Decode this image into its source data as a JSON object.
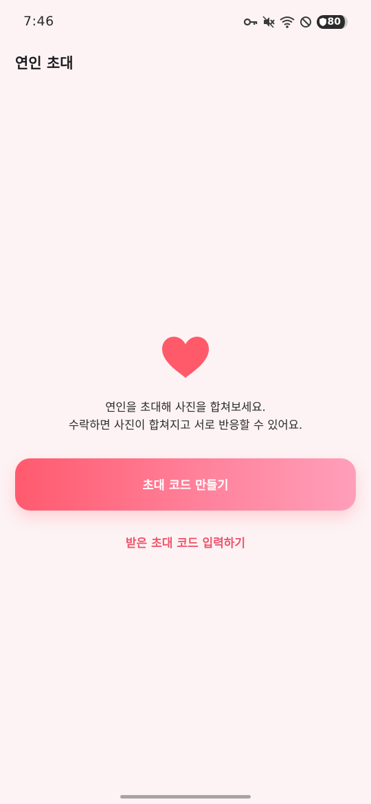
{
  "status_bar": {
    "time": "7:46",
    "battery": "80",
    "icons": [
      "key-icon",
      "vibrate-mute-icon",
      "wifi-icon",
      "do-not-disturb-icon",
      "battery-icon"
    ]
  },
  "header": {
    "title": "연인 초대"
  },
  "main": {
    "icon": "heart-icon",
    "description_line1": "연인을 초대해 사진을 합쳐보세요.",
    "description_line2": "수락하면 사진이 합쳐지고 서로 반응할 수 있어요.",
    "primary_button_label": "초대 코드 만들기",
    "secondary_link_label": "받은 초대 코드 입력하기"
  },
  "colors": {
    "background": "#FDF3F4",
    "accent": "#FF5A6E",
    "accent_gradient_end": "#FF9FBA",
    "link": "#F0546B",
    "heart": "#FF5A6A"
  }
}
